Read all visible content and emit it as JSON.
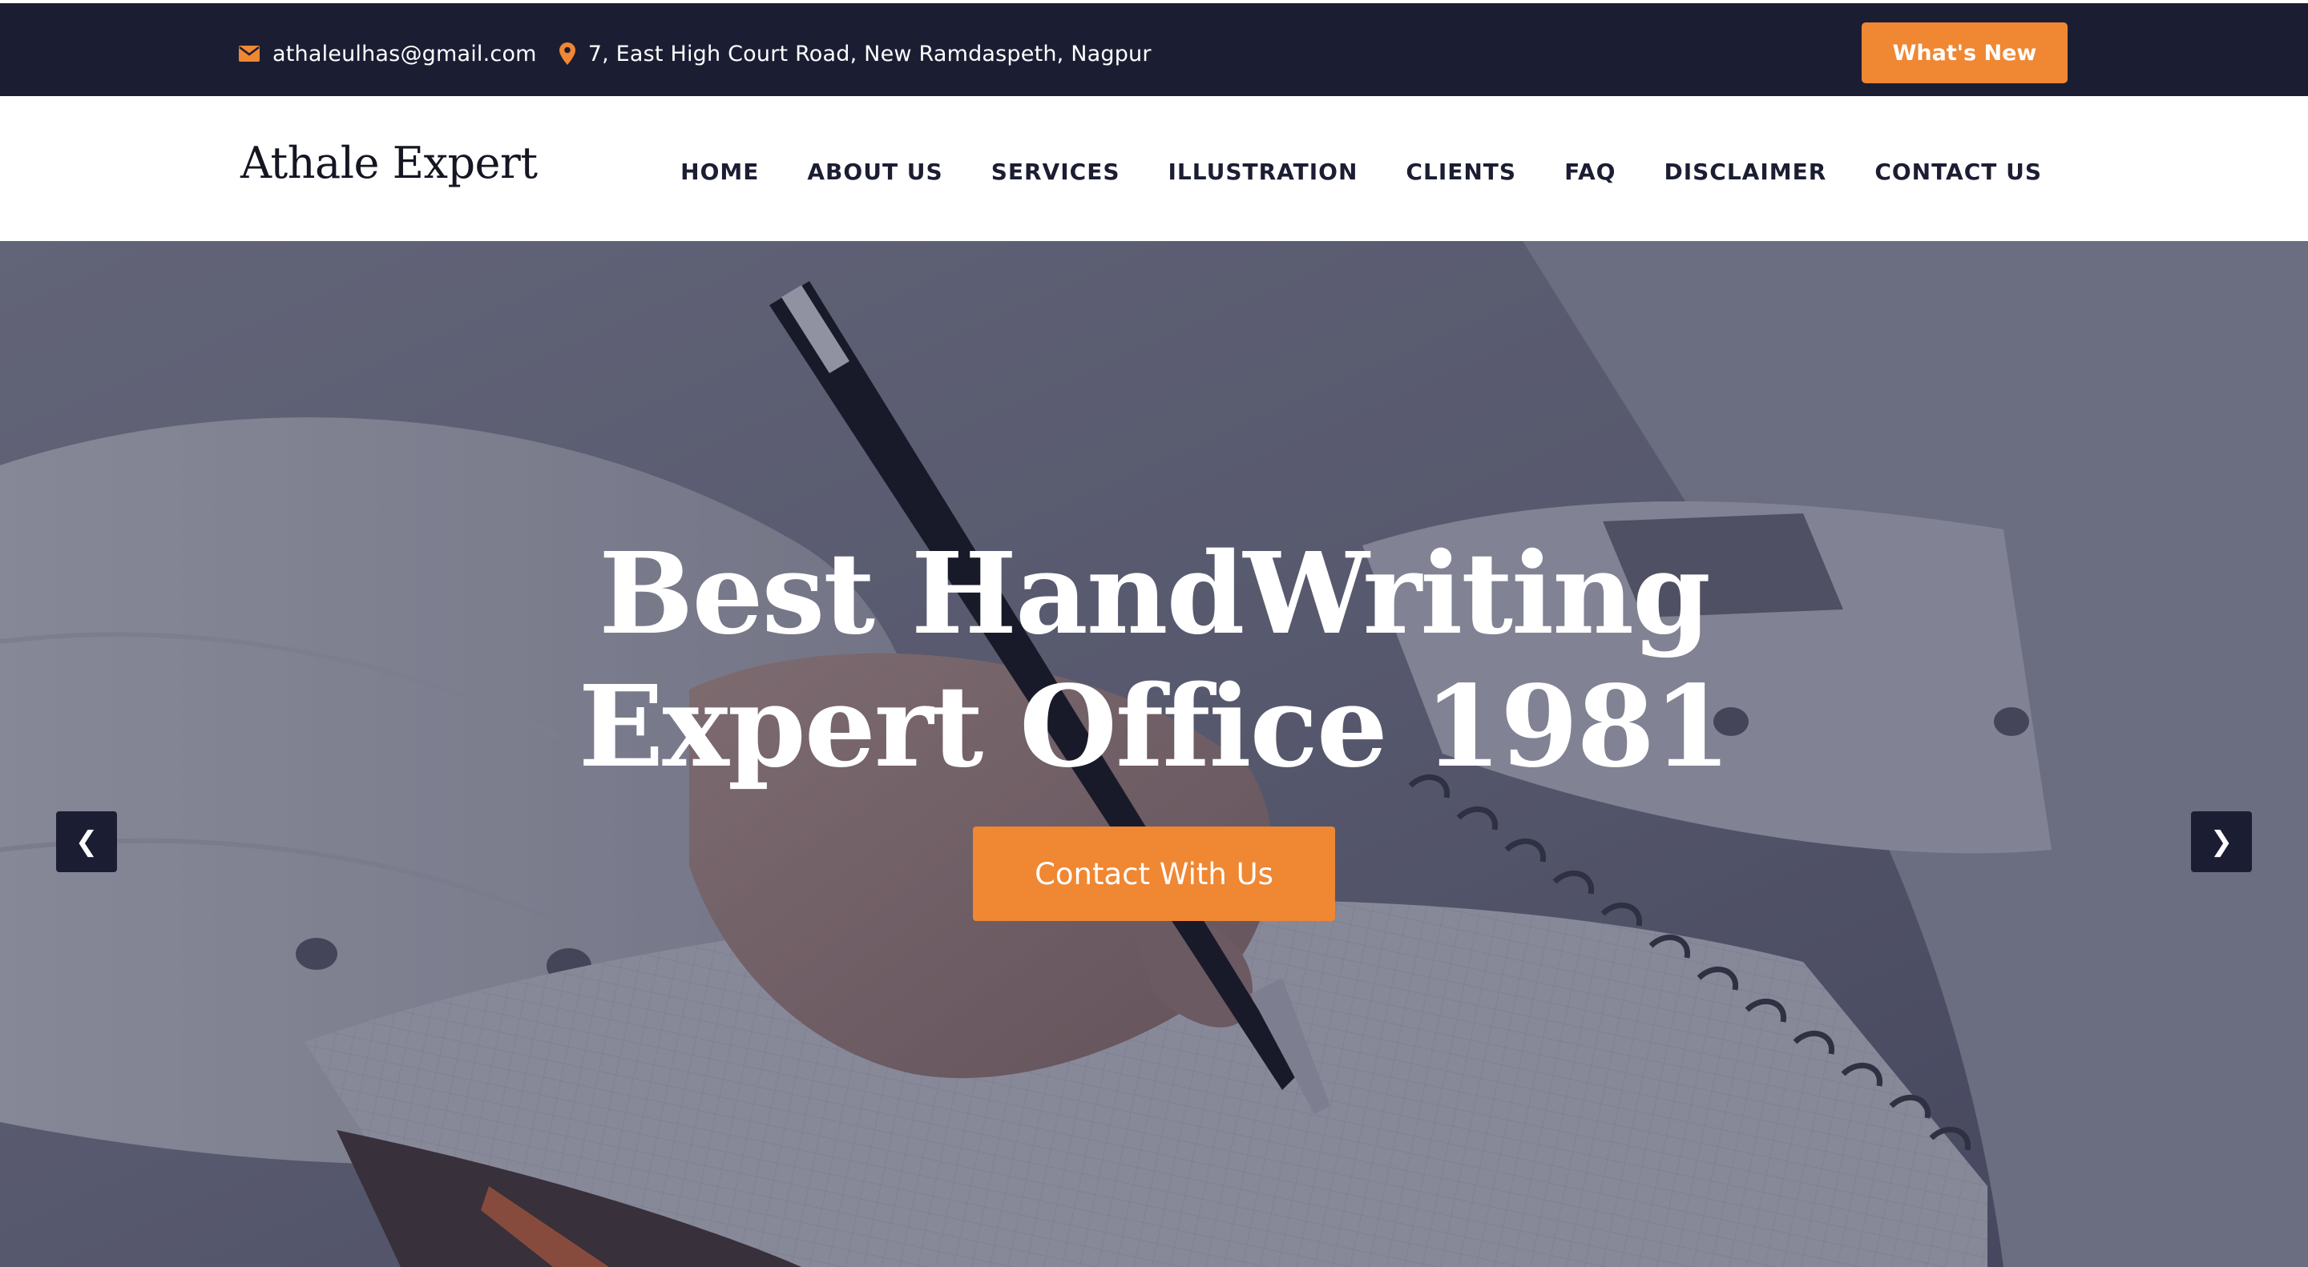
{
  "topbar": {
    "email": "athaleulhas@gmail.com",
    "address": "7, East High Court Road, New Ramdaspeth, Nagpur",
    "email_icon": "envelope-icon",
    "address_icon": "map-marker-icon",
    "cta_label": "What's New"
  },
  "header": {
    "logo": "Athale Expert",
    "nav": [
      {
        "label": "HOME"
      },
      {
        "label": "ABOUT US"
      },
      {
        "label": "SERVICES"
      },
      {
        "label": "ILLUSTRATION"
      },
      {
        "label": "CLIENTS"
      },
      {
        "label": "FAQ"
      },
      {
        "label": "DISCLAIMER"
      },
      {
        "label": "CONTACT US"
      }
    ]
  },
  "hero": {
    "title_line1": "Best HandWriting",
    "title_line2": "Expert Office 1981",
    "cta_label": "Contact With Us",
    "prev_arrow": "❮",
    "next_arrow": "❯",
    "background_image": "hand-writing-with-pen-on-notebook"
  },
  "colors": {
    "navy": "#1b1e33",
    "accent_orange": "#ef8733",
    "white": "#ffffff"
  }
}
